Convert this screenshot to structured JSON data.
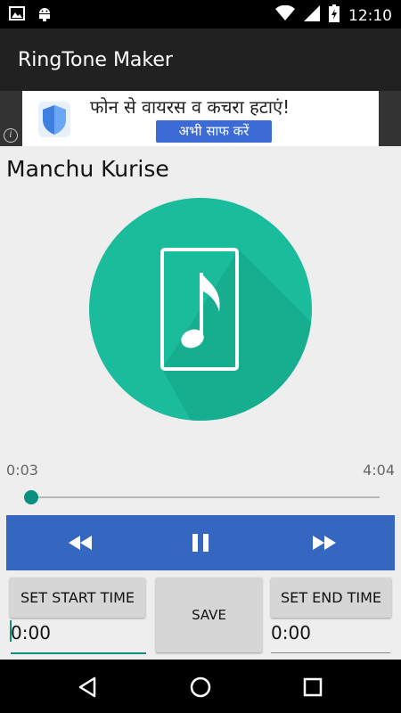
{
  "status_bar": {
    "time": "12:10",
    "icons_left": [
      "image-icon",
      "android-icon"
    ],
    "icons_right": [
      "wifi-icon",
      "signal-icon",
      "battery-icon"
    ]
  },
  "app_bar": {
    "title": "RingTone Maker"
  },
  "ad": {
    "headline": "फोन से वायरस व कचरा हटाएं!",
    "cta": "अभी साफ करें",
    "icons": [
      "info-icon",
      "shield-icon"
    ]
  },
  "song": {
    "title": "Manchu Kurise"
  },
  "player": {
    "elapsed": "0:03",
    "total": "4:04",
    "progress": 0.012,
    "controls": [
      "rewind-icon",
      "pause-icon",
      "fast-forward-icon"
    ]
  },
  "editor": {
    "set_start_label": "SET START TIME",
    "save_label": "SAVE",
    "set_end_label": "SET END TIME",
    "start_value": "0:00",
    "end_value": "0:00"
  },
  "colors": {
    "accent": "#1bbc9b",
    "controls_bar": "#3567c1",
    "app_bar": "#212121",
    "seek_thumb": "#0c8f80"
  },
  "nav": [
    "back-icon",
    "home-icon",
    "recents-icon"
  ]
}
